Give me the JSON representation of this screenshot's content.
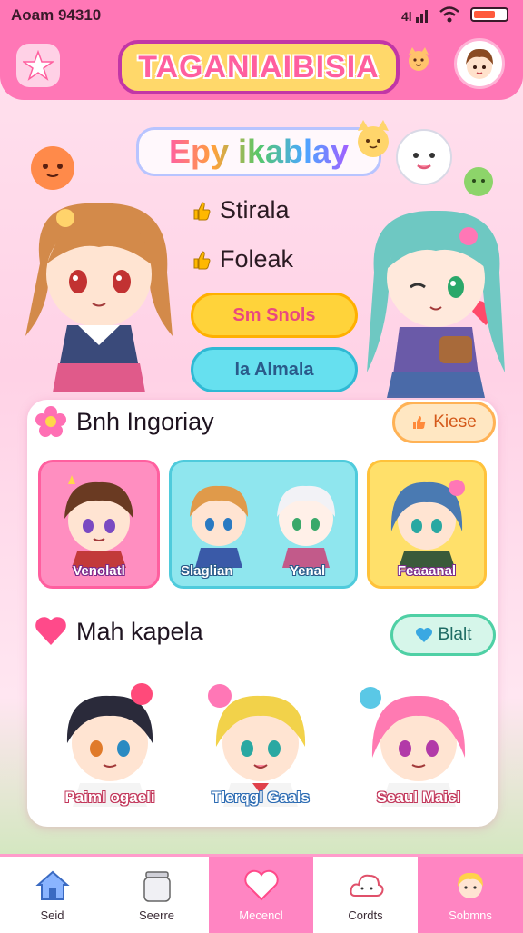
{
  "status_bar": {
    "time": "Aoam 94310",
    "signal_text": "4l"
  },
  "header": {
    "logo_text": "TAGANIAIBISIA"
  },
  "hero": {
    "title": "Epy ikablay",
    "features": [
      "Stirala",
      "Foleak"
    ],
    "buttons": {
      "primary": "Sm Snols",
      "secondary": "la Almala"
    }
  },
  "section_one": {
    "title": "Bnh Ingoriay",
    "action_label": "Kiese",
    "cards": [
      {
        "label": "Venolatl"
      },
      {
        "label_left": "Slaglian",
        "label_right": "Yenal"
      },
      {
        "label": "Feaaanal"
      }
    ]
  },
  "section_two": {
    "title": "Mah kapela",
    "action_label": "Blalt",
    "characters": [
      {
        "label": "Paiml ogaeli"
      },
      {
        "label": "Tlerqgl Gaals"
      },
      {
        "label": "Seaul Maicl"
      }
    ]
  },
  "bottom_nav": [
    {
      "label": "Seid",
      "icon": "home-icon"
    },
    {
      "label": "Seerre",
      "icon": "jar-icon"
    },
    {
      "label": "Mecencl",
      "icon": "heart-icon"
    },
    {
      "label": "Cordts",
      "icon": "cloud-icon"
    },
    {
      "label": "Sobmns",
      "icon": "character-icon"
    }
  ],
  "colors": {
    "header_pink": "#ff77b6",
    "logo_yellow": "#ffd86a",
    "button_yellow": "#ffd33a",
    "button_cyan": "#66e0ef",
    "nav_active": "#ff85c2"
  }
}
